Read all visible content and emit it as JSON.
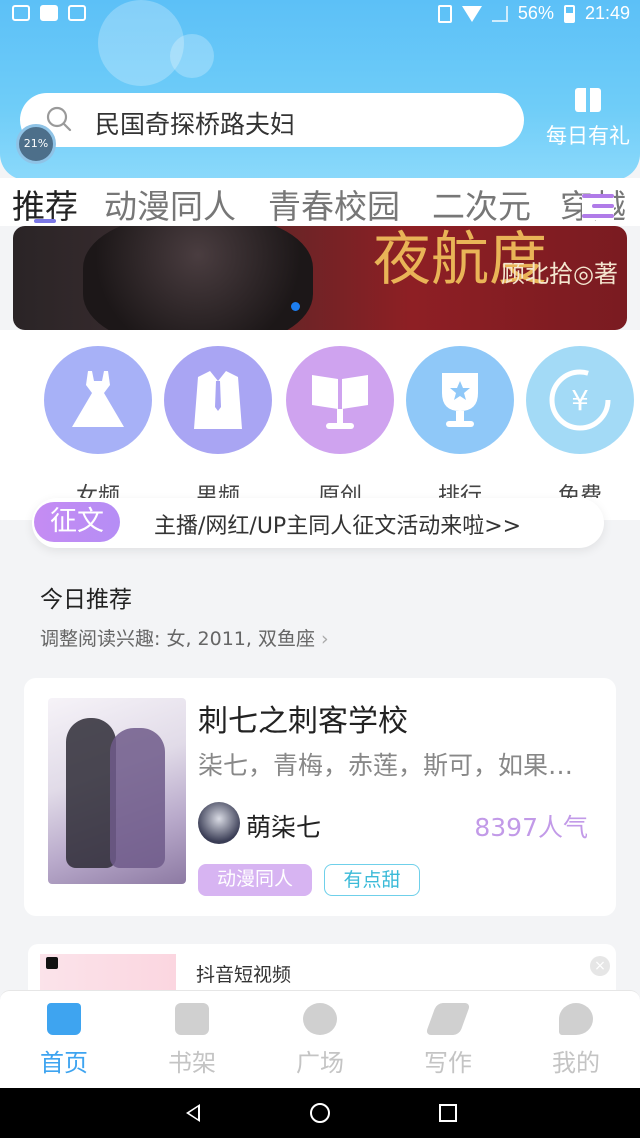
{
  "status_bar": {
    "battery": "56%",
    "time": "21:49"
  },
  "search": {
    "text": "民国奇探桥路夫妇",
    "progress": "21%"
  },
  "gift": {
    "label": "每日有礼"
  },
  "tabs": [
    "推荐",
    "动漫同人",
    "青春校园",
    "二次元",
    "穿越"
  ],
  "banner": {
    "title": "夜航度",
    "author": "顾北拾◎著"
  },
  "categories": [
    {
      "label": "女频",
      "icon": "dress-icon",
      "color": "#a7b1f7"
    },
    {
      "label": "男频",
      "icon": "shirt-icon",
      "color": "#a9a5f3"
    },
    {
      "label": "原创",
      "icon": "book-stand-icon",
      "color": "#cfa3ef"
    },
    {
      "label": "排行",
      "icon": "trophy-icon",
      "color": "#8fc8f8"
    },
    {
      "label": "免费",
      "icon": "yuan-icon",
      "color": "#a3daf6"
    }
  ],
  "notice": {
    "badge": "征文",
    "text": "主播/网红/UP主同人征文活动来啦>>"
  },
  "recommend": {
    "title": "今日推荐",
    "subtitle": "调整阅读兴趣: 女, 2011, 双鱼座"
  },
  "book": {
    "title": "刺七之刺客学校",
    "characters": "柒七，青梅，赤莲，斯可，如果…",
    "author": "萌柒七",
    "popularity": "8397人气",
    "tags": [
      "动漫同人",
      "有点甜"
    ]
  },
  "ad": {
    "text": "抖音短视频"
  },
  "bottom_nav": [
    {
      "label": "首页",
      "icon": "home-icon",
      "active": true
    },
    {
      "label": "书架",
      "icon": "bookshelf-icon",
      "active": false
    },
    {
      "label": "广场",
      "icon": "planet-icon",
      "active": false
    },
    {
      "label": "写作",
      "icon": "pen-icon",
      "active": false
    },
    {
      "label": "我的",
      "icon": "chat-icon",
      "active": false
    }
  ]
}
